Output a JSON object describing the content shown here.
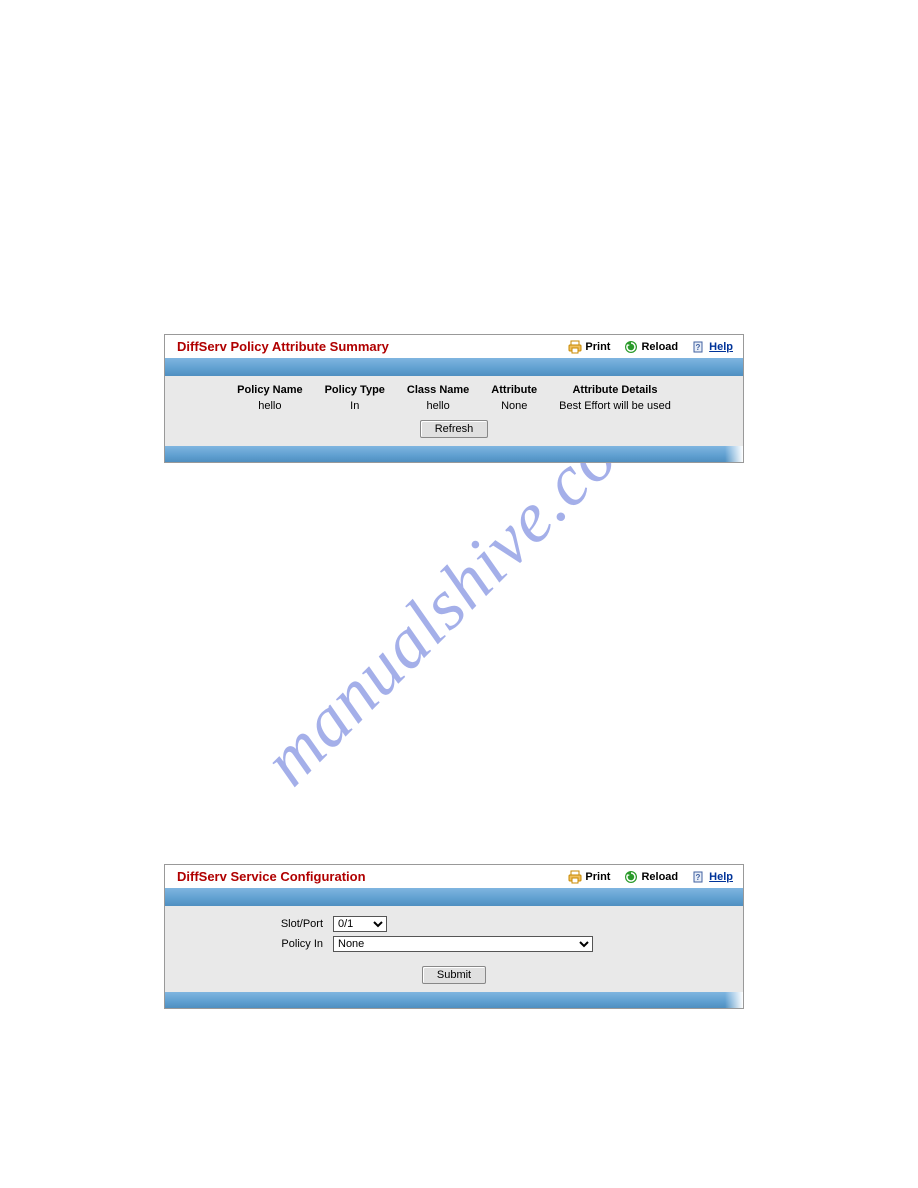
{
  "watermark": "manualshive.com",
  "toolbar": {
    "print": "Print",
    "reload": "Reload",
    "help": "Help"
  },
  "panel1": {
    "title": "DiffServ Policy Attribute Summary",
    "headers": {
      "policy_name": "Policy Name",
      "policy_type": "Policy Type",
      "class_name": "Class Name",
      "attribute": "Attribute",
      "attribute_details": "Attribute Details"
    },
    "row": {
      "policy_name": "hello",
      "policy_type": "In",
      "class_name": "hello",
      "attribute": "None",
      "attribute_details": "Best Effort will be used"
    },
    "refresh": "Refresh"
  },
  "panel2": {
    "title": "DiffServ Service Configuration",
    "slot_port_label": "Slot/Port",
    "slot_port_value": "0/1",
    "policy_in_label": "Policy In",
    "policy_in_value": "None",
    "submit": "Submit"
  }
}
